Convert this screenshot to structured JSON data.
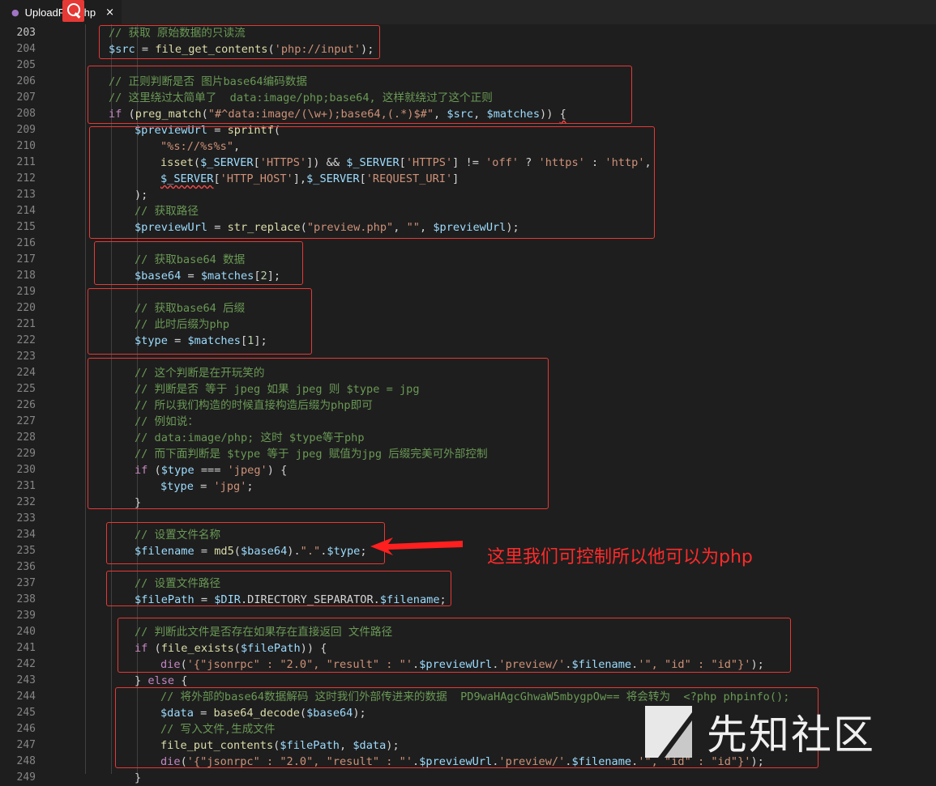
{
  "tab": {
    "filename": "UploadFile.php",
    "close_glyph": "×"
  },
  "annotation": {
    "text": "这里我们可控制所以他可以为php",
    "color": "#ff2a2a"
  },
  "watermark": {
    "text": "先知社区"
  },
  "colors": {
    "comment": "#6a9955",
    "variable": "#9cdcfe",
    "function": "#dcdcaa",
    "keyword": "#c586c0",
    "string": "#ce9178",
    "highlight_box": "#e53935"
  },
  "lines": [
    {
      "n": "203",
      "ind": 2,
      "t": [
        [
          "c",
          "// 获取 原始数据的只读流"
        ]
      ]
    },
    {
      "n": "204",
      "ind": 2,
      "t": [
        [
          "v",
          "$src"
        ],
        [
          "p",
          " = "
        ],
        [
          "f",
          "file_get_contents"
        ],
        [
          "p",
          "("
        ],
        [
          "s",
          "'php://input'"
        ],
        [
          "p",
          ");"
        ]
      ]
    },
    {
      "n": "205",
      "ind": 0,
      "t": []
    },
    {
      "n": "206",
      "ind": 2,
      "t": [
        [
          "c",
          "// 正则判断是否 图片base64编码数据"
        ]
      ]
    },
    {
      "n": "207",
      "ind": 2,
      "t": [
        [
          "c",
          "// 这里绕过太简单了  data:image/php;base64, 这样就绕过了这个正则"
        ]
      ]
    },
    {
      "n": "208",
      "ind": 2,
      "t": [
        [
          "k",
          "if"
        ],
        [
          "p",
          " ("
        ],
        [
          "f",
          "preg_match"
        ],
        [
          "p",
          "("
        ],
        [
          "s",
          "\"#^data:image/(\\w+);base64,(.*)$#\""
        ],
        [
          "p",
          ", "
        ],
        [
          "v",
          "$src"
        ],
        [
          "p",
          ", "
        ],
        [
          "v",
          "$matches"
        ],
        [
          "p",
          ")) "
        ],
        [
          "sq",
          "{"
        ]
      ]
    },
    {
      "n": "209",
      "ind": 3,
      "t": [
        [
          "v",
          "$previewUrl"
        ],
        [
          "p",
          " = "
        ],
        [
          "f",
          "sprintf"
        ],
        [
          "p",
          "("
        ]
      ]
    },
    {
      "n": "210",
      "ind": 4,
      "t": [
        [
          "s",
          "\"%s://%s%s\""
        ],
        [
          "p",
          ","
        ]
      ]
    },
    {
      "n": "211",
      "ind": 4,
      "t": [
        [
          "f",
          "isset"
        ],
        [
          "p",
          "("
        ],
        [
          "v",
          "$_SERVER"
        ],
        [
          "p",
          "["
        ],
        [
          "s",
          "'HTTPS'"
        ],
        [
          "p",
          "]) && "
        ],
        [
          "v",
          "$_SERVER"
        ],
        [
          "p",
          "["
        ],
        [
          "s",
          "'HTTPS'"
        ],
        [
          "p",
          "] != "
        ],
        [
          "s",
          "'off'"
        ],
        [
          "p",
          " ? "
        ],
        [
          "s",
          "'https'"
        ],
        [
          "p",
          " : "
        ],
        [
          "s",
          "'http'"
        ],
        [
          "p",
          ","
        ]
      ]
    },
    {
      "n": "212",
      "ind": 4,
      "t": [
        [
          "sqv",
          "$_SERVER"
        ],
        [
          "p",
          "["
        ],
        [
          "s",
          "'HTTP_HOST'"
        ],
        [
          "p",
          "],"
        ],
        [
          "v",
          "$_SERVER"
        ],
        [
          "p",
          "["
        ],
        [
          "s",
          "'REQUEST_URI'"
        ],
        [
          "p",
          "]"
        ]
      ]
    },
    {
      "n": "213",
      "ind": 3,
      "t": [
        [
          "p",
          ");"
        ]
      ]
    },
    {
      "n": "214",
      "ind": 3,
      "t": [
        [
          "c",
          "// 获取路径"
        ]
      ]
    },
    {
      "n": "215",
      "ind": 3,
      "t": [
        [
          "v",
          "$previewUrl"
        ],
        [
          "p",
          " = "
        ],
        [
          "f",
          "str_replace"
        ],
        [
          "p",
          "("
        ],
        [
          "s",
          "\"preview.php\""
        ],
        [
          "p",
          ", "
        ],
        [
          "s",
          "\"\""
        ],
        [
          "p",
          ", "
        ],
        [
          "v",
          "$previewUrl"
        ],
        [
          "p",
          ");"
        ]
      ]
    },
    {
      "n": "216",
      "ind": 0,
      "t": []
    },
    {
      "n": "217",
      "ind": 3,
      "t": [
        [
          "c",
          "// 获取base64 数据"
        ]
      ]
    },
    {
      "n": "218",
      "ind": 3,
      "t": [
        [
          "v",
          "$base64"
        ],
        [
          "p",
          " = "
        ],
        [
          "v",
          "$matches"
        ],
        [
          "p",
          "["
        ],
        [
          "n",
          "2"
        ],
        [
          "p",
          "];"
        ]
      ]
    },
    {
      "n": "219",
      "ind": 0,
      "t": []
    },
    {
      "n": "220",
      "ind": 3,
      "t": [
        [
          "c",
          "// 获取base64 后缀"
        ]
      ]
    },
    {
      "n": "221",
      "ind": 3,
      "t": [
        [
          "c",
          "// 此时后缀为php"
        ]
      ]
    },
    {
      "n": "222",
      "ind": 3,
      "t": [
        [
          "v",
          "$type"
        ],
        [
          "p",
          " = "
        ],
        [
          "v",
          "$matches"
        ],
        [
          "p",
          "["
        ],
        [
          "n",
          "1"
        ],
        [
          "p",
          "];"
        ]
      ]
    },
    {
      "n": "223",
      "ind": 0,
      "t": []
    },
    {
      "n": "224",
      "ind": 3,
      "t": [
        [
          "c",
          "// 这个判断是在开玩笑的"
        ]
      ]
    },
    {
      "n": "225",
      "ind": 3,
      "t": [
        [
          "c",
          "// 判断是否 等于 jpeg 如果 jpeg 则 $type = jpg"
        ]
      ]
    },
    {
      "n": "226",
      "ind": 3,
      "t": [
        [
          "c",
          "// 所以我们构造的时候直接构造后缀为php即可"
        ]
      ]
    },
    {
      "n": "227",
      "ind": 3,
      "t": [
        [
          "c",
          "// 例如说："
        ]
      ]
    },
    {
      "n": "228",
      "ind": 3,
      "t": [
        [
          "c",
          "// data:image/php; 这时 $type等于php"
        ]
      ]
    },
    {
      "n": "229",
      "ind": 3,
      "t": [
        [
          "c",
          "// 而下面判断是 $type 等于 jpeg 赋值为jpg 后缀完美可外部控制"
        ]
      ]
    },
    {
      "n": "230",
      "ind": 3,
      "t": [
        [
          "k",
          "if"
        ],
        [
          "p",
          " ("
        ],
        [
          "v",
          "$type"
        ],
        [
          "p",
          " === "
        ],
        [
          "s",
          "'jpeg'"
        ],
        [
          "p",
          ") {"
        ]
      ]
    },
    {
      "n": "231",
      "ind": 4,
      "t": [
        [
          "v",
          "$type"
        ],
        [
          "p",
          " = "
        ],
        [
          "s",
          "'jpg'"
        ],
        [
          "p",
          ";"
        ]
      ]
    },
    {
      "n": "232",
      "ind": 3,
      "t": [
        [
          "p",
          "}"
        ]
      ]
    },
    {
      "n": "233",
      "ind": 0,
      "t": []
    },
    {
      "n": "234",
      "ind": 3,
      "t": [
        [
          "c",
          "// 设置文件名称"
        ]
      ]
    },
    {
      "n": "235",
      "ind": 3,
      "t": [
        [
          "v",
          "$filename"
        ],
        [
          "p",
          " = "
        ],
        [
          "f",
          "md5"
        ],
        [
          "p",
          "("
        ],
        [
          "v",
          "$base64"
        ],
        [
          "p",
          ")."
        ],
        [
          "s",
          "\".\""
        ],
        [
          "p",
          "."
        ],
        [
          "v",
          "$type"
        ],
        [
          "p",
          ";"
        ]
      ]
    },
    {
      "n": "236",
      "ind": 0,
      "t": []
    },
    {
      "n": "237",
      "ind": 3,
      "t": [
        [
          "c",
          "// 设置文件路径"
        ]
      ]
    },
    {
      "n": "238",
      "ind": 3,
      "t": [
        [
          "v",
          "$filePath"
        ],
        [
          "p",
          " = "
        ],
        [
          "v",
          "$DIR"
        ],
        [
          "p",
          ".DIRECTORY_SEPARATOR."
        ],
        [
          "v",
          "$filename"
        ],
        [
          "p",
          ";"
        ]
      ]
    },
    {
      "n": "239",
      "ind": 0,
      "t": []
    },
    {
      "n": "240",
      "ind": 3,
      "t": [
        [
          "c",
          "// 判断此文件是否存在如果存在直接返回 文件路径"
        ]
      ]
    },
    {
      "n": "241",
      "ind": 3,
      "t": [
        [
          "k",
          "if"
        ],
        [
          "p",
          " ("
        ],
        [
          "f",
          "file_exists"
        ],
        [
          "p",
          "("
        ],
        [
          "v",
          "$filePath"
        ],
        [
          "p",
          ")) {"
        ]
      ]
    },
    {
      "n": "242",
      "ind": 4,
      "t": [
        [
          "k",
          "die"
        ],
        [
          "p",
          "("
        ],
        [
          "s",
          "'{\"jsonrpc\" : \"2.0\", \"result\" : \"'"
        ],
        [
          "p",
          "."
        ],
        [
          "v",
          "$previewUrl"
        ],
        [
          "p",
          "."
        ],
        [
          "s",
          "'preview/'"
        ],
        [
          "p",
          "."
        ],
        [
          "v",
          "$filename"
        ],
        [
          "p",
          "."
        ],
        [
          "s",
          "'\", \"id\" : \"id\"}'"
        ],
        [
          "p",
          ");"
        ]
      ]
    },
    {
      "n": "243",
      "ind": 3,
      "t": [
        [
          "p",
          "} "
        ],
        [
          "k",
          "else"
        ],
        [
          "p",
          " {"
        ]
      ]
    },
    {
      "n": "244",
      "ind": 4,
      "t": [
        [
          "c",
          "// 将外部的base64数据解码 这时我们外部传进来的数据  PD9waHAgcGhwaW5mbygpOw== 将会转为  <?php phpinfo();"
        ]
      ]
    },
    {
      "n": "245",
      "ind": 4,
      "t": [
        [
          "v",
          "$data"
        ],
        [
          "p",
          " = "
        ],
        [
          "f",
          "base64_decode"
        ],
        [
          "p",
          "("
        ],
        [
          "v",
          "$base64"
        ],
        [
          "p",
          ");"
        ]
      ]
    },
    {
      "n": "246",
      "ind": 4,
      "t": [
        [
          "c",
          "// 写入文件,生成文件"
        ]
      ]
    },
    {
      "n": "247",
      "ind": 4,
      "t": [
        [
          "f",
          "file_put_contents"
        ],
        [
          "p",
          "("
        ],
        [
          "v",
          "$filePath"
        ],
        [
          "p",
          ", "
        ],
        [
          "v",
          "$data"
        ],
        [
          "p",
          ");"
        ]
      ]
    },
    {
      "n": "248",
      "ind": 4,
      "t": [
        [
          "k",
          "die"
        ],
        [
          "p",
          "("
        ],
        [
          "s",
          "'{\"jsonrpc\" : \"2.0\", \"result\" : \"'"
        ],
        [
          "p",
          "."
        ],
        [
          "v",
          "$previewUrl"
        ],
        [
          "p",
          "."
        ],
        [
          "s",
          "'preview/'"
        ],
        [
          "p",
          "."
        ],
        [
          "v",
          "$filename"
        ],
        [
          "p",
          "."
        ],
        [
          "s",
          "'\", \"id\" : \"id\"}'"
        ],
        [
          "p",
          ");"
        ]
      ]
    },
    {
      "n": "249",
      "ind": 3,
      "t": [
        [
          "p",
          "}"
        ]
      ]
    }
  ]
}
